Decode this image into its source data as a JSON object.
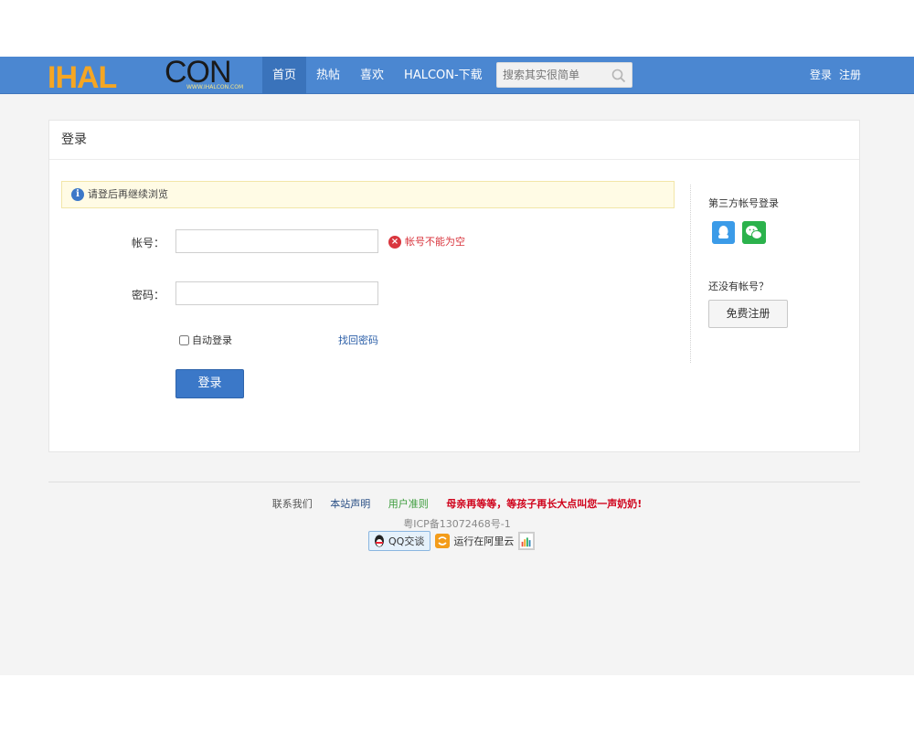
{
  "brand": {
    "logo_left": "IHAL",
    "logo_right": "CON",
    "logo_url_text": "WWW.IHALCON.COM"
  },
  "nav": {
    "items": [
      {
        "label": "首页",
        "active": true
      },
      {
        "label": "热帖",
        "active": false
      },
      {
        "label": "喜欢",
        "active": false
      },
      {
        "label": "HALCON-下载",
        "active": false
      }
    ]
  },
  "search": {
    "placeholder": "搜索其实很简单",
    "icon": "search-icon"
  },
  "auth": {
    "login": "登录",
    "register": "注册"
  },
  "panel": {
    "title": "登录",
    "notice": "请登后再继续浏览",
    "account_label": "帐号：",
    "account_value": "",
    "account_error": "帐号不能为空",
    "password_label": "密码：",
    "password_value": "",
    "remember_label": "自动登录",
    "remember_checked": false,
    "forgot_label": "找回密码",
    "submit_label": "登录",
    "third_party_title": "第三方帐号登录",
    "third_party_icons": [
      "qq-icon",
      "wechat-icon"
    ],
    "no_account_text": "还没有帐号？",
    "register_button": "免费注册"
  },
  "footer": {
    "links": {
      "contact": "联系我们",
      "statement": "本站声明",
      "rules": "用户准则",
      "slogan": "母亲再等等，等孩子再长大点叫您一声奶奶!"
    },
    "icp": "粤ICP备13072468号-1",
    "qq_badge": "QQ交谈",
    "aliyun": "运行在阿里云"
  },
  "colors": {
    "header": "#4b87d1",
    "nav_active": "#3a73bb",
    "primary_button": "#3b78c8",
    "error": "#d9363e",
    "notice_bg": "#fffbe5"
  }
}
